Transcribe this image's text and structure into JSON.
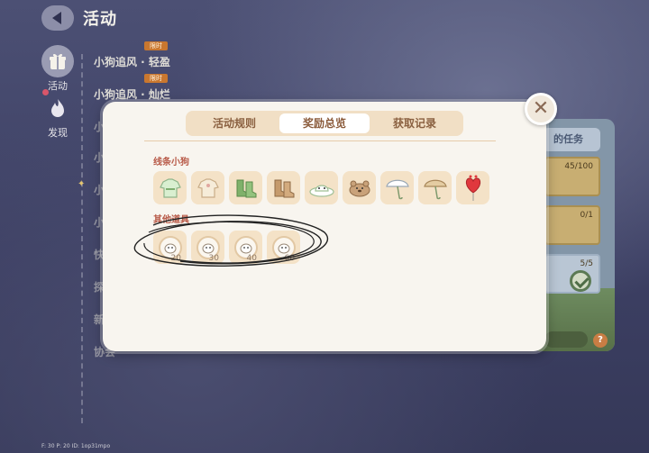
{
  "header": {
    "title": "活动"
  },
  "side_rail": [
    {
      "label": "活动",
      "icon": "gift-icon"
    },
    {
      "label": "发现",
      "icon": "flame-icon"
    }
  ],
  "activity_list": [
    {
      "label": "小狗追风 · 轻盈",
      "tag": "限时"
    },
    {
      "label": "小狗追风 · 灿烂",
      "tag": "限时"
    },
    {
      "label": "小"
    },
    {
      "label": "小"
    },
    {
      "label": "小"
    },
    {
      "label": "小"
    },
    {
      "label": "快"
    },
    {
      "label": "探"
    },
    {
      "label": "新"
    },
    {
      "label": "协会"
    }
  ],
  "right_card": {
    "header": "的任务",
    "progress_1": "45/100",
    "progress_2": "0/1",
    "progress_3": "5/5",
    "help": "?"
  },
  "footer_debug": "F: 30    P: 20    ID: 1op31mpo",
  "modal": {
    "tabs": [
      {
        "label": "活动规则",
        "active": false
      },
      {
        "label": "奖励总览",
        "active": true
      },
      {
        "label": "获取记录",
        "active": false
      }
    ],
    "section_dogs": {
      "title": "线条小狗",
      "items": [
        "dog-outfit-green-icon",
        "dog-outfit-cream-icon",
        "green-boots-icon",
        "brown-boots-icon",
        "sun-hat-icon",
        "teddy-bear-icon",
        "white-umbrella-icon",
        "beige-umbrella-icon",
        "red-heart-balloon-icon"
      ]
    },
    "section_props": {
      "title": "其他道具",
      "items": [
        {
          "icon": "pet-coin-icon",
          "qty": "20"
        },
        {
          "icon": "pet-coin-icon",
          "qty": "30"
        },
        {
          "icon": "pet-coin-icon",
          "qty": "40"
        },
        {
          "icon": "pet-coin-icon",
          "qty": "60"
        }
      ]
    },
    "close_icon": "close-icon"
  },
  "colors": {
    "modal_bg": "#f8f5ef",
    "tab_bar": "#f1dfc5",
    "section_title": "#b85a48",
    "item_bg": "#f4e2c7",
    "limited_tag": "#c9772f"
  }
}
